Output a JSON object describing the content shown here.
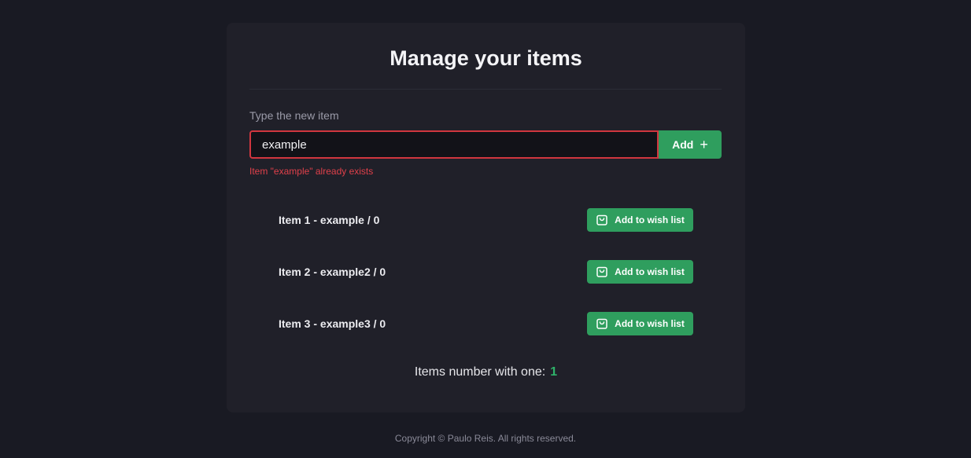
{
  "header": {
    "title": "Manage your items"
  },
  "form": {
    "label": "Type the new item",
    "input_value": "example",
    "add_label": "Add",
    "add_icon": "plus-icon",
    "error": "Item \"example\" already exists"
  },
  "items": [
    {
      "label": "Item 1 - example / 0",
      "button_label": "Add to wish list",
      "icon": "shopping-bag-icon"
    },
    {
      "label": "Item 2 - example2 / 0",
      "button_label": "Add to wish list",
      "icon": "shopping-bag-icon"
    },
    {
      "label": "Item 3 - example3 / 0",
      "button_label": "Add to wish list",
      "icon": "shopping-bag-icon"
    }
  ],
  "counter": {
    "label": "Items number with one:",
    "value": "1"
  },
  "footer": {
    "text": "Copyright © Paulo Reis. All rights reserved."
  },
  "colors": {
    "background": "#191a23",
    "card": "#202029",
    "accent_green": "#2f9e5e",
    "error_red": "#d0363f"
  }
}
